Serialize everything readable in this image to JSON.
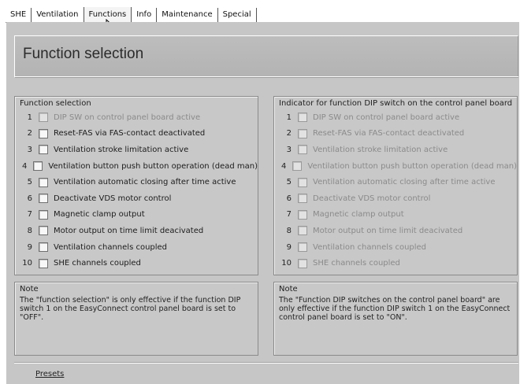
{
  "tabs": [
    {
      "label": "SHE",
      "active": false
    },
    {
      "label": "Ventilation",
      "active": false
    },
    {
      "label": "Functions",
      "active": true
    },
    {
      "label": "Info",
      "active": false
    },
    {
      "label": "Maintenance",
      "active": false
    },
    {
      "label": "Special",
      "active": false
    }
  ],
  "page_title": "Function selection",
  "function_selection": {
    "title": "Function selection",
    "items": [
      {
        "num": "1",
        "label": "DIP SW on control panel board active",
        "enabled": false,
        "checked": false
      },
      {
        "num": "2",
        "label": "Reset-FAS via FAS-contact deactivated",
        "enabled": true,
        "checked": false
      },
      {
        "num": "3",
        "label": "Ventilation stroke limitation active",
        "enabled": true,
        "checked": false
      },
      {
        "num": "4",
        "label": "Ventilation button push button operation (dead man)",
        "enabled": true,
        "checked": false
      },
      {
        "num": "5",
        "label": "Ventilation automatic closing after time active",
        "enabled": true,
        "checked": false
      },
      {
        "num": "6",
        "label": "Deactivate VDS motor control",
        "enabled": true,
        "checked": false
      },
      {
        "num": "7",
        "label": "Magnetic clamp output",
        "enabled": true,
        "checked": false
      },
      {
        "num": "8",
        "label": "Motor output on time limit deacivated",
        "enabled": true,
        "checked": false
      },
      {
        "num": "9",
        "label": "Ventilation channels coupled",
        "enabled": true,
        "checked": false
      },
      {
        "num": "10",
        "label": "SHE channels coupled",
        "enabled": true,
        "checked": false
      }
    ]
  },
  "dip_indicator": {
    "title": "Indicator for function DIP switch on the control panel board",
    "items": [
      {
        "num": "1",
        "label": "DIP SW on control panel board active",
        "enabled": false,
        "checked": false
      },
      {
        "num": "2",
        "label": "Reset-FAS via FAS-contact deactivated",
        "enabled": false,
        "checked": false
      },
      {
        "num": "3",
        "label": "Ventilation stroke limitation active",
        "enabled": false,
        "checked": false
      },
      {
        "num": "4",
        "label": "Ventilation button push button operation (dead man)",
        "enabled": false,
        "checked": false
      },
      {
        "num": "5",
        "label": "Ventilation automatic closing after time active",
        "enabled": false,
        "checked": false
      },
      {
        "num": "6",
        "label": "Deactivate VDS motor control",
        "enabled": false,
        "checked": false
      },
      {
        "num": "7",
        "label": "Magnetic clamp output",
        "enabled": false,
        "checked": false
      },
      {
        "num": "8",
        "label": "Motor output on time limit deacivated",
        "enabled": false,
        "checked": false
      },
      {
        "num": "9",
        "label": "Ventilation channels coupled",
        "enabled": false,
        "checked": false
      },
      {
        "num": "10",
        "label": "SHE channels coupled",
        "enabled": false,
        "checked": false
      }
    ]
  },
  "note_left": {
    "title": "Note",
    "text": "The \"function selection\" is only effective if the function DIP switch 1 on the EasyConnect control panel board is set to \"OFF\"."
  },
  "note_right": {
    "title": "Note",
    "text": "The \"Function DIP switches on the control panel board\" are only effective if the function DIP switch 1 on the EasyConnect control panel board is set to \"ON\"."
  },
  "presets_label": "Presets",
  "colors": {
    "panel": "#c6c6c6",
    "disabled_text": "#8a8a8a"
  }
}
